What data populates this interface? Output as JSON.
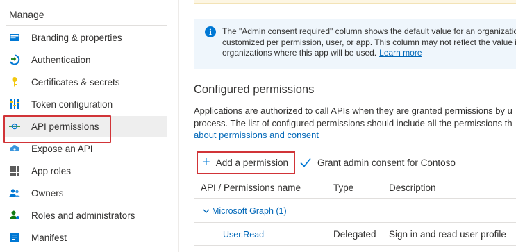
{
  "sidebar": {
    "heading": "Manage",
    "items": [
      {
        "label": "Branding & properties",
        "icon": "branding-icon"
      },
      {
        "label": "Authentication",
        "icon": "authentication-icon"
      },
      {
        "label": "Certificates & secrets",
        "icon": "key-icon"
      },
      {
        "label": "Token configuration",
        "icon": "token-bars-icon"
      },
      {
        "label": "API permissions",
        "icon": "api-permissions-icon",
        "selected": true
      },
      {
        "label": "Expose an API",
        "icon": "cloud-icon"
      },
      {
        "label": "App roles",
        "icon": "grid-icon"
      },
      {
        "label": "Owners",
        "icon": "people-icon"
      },
      {
        "label": "Roles and administrators",
        "icon": "person-badge-icon"
      },
      {
        "label": "Manifest",
        "icon": "manifest-icon"
      }
    ]
  },
  "info": {
    "line1": "The \"Admin consent required\" column shows the default value for an organizatio",
    "line2": "customized per permission, user, or app. This column may not reflect the value in",
    "line3": "organizations where this app will be used.",
    "learn_more": "Learn more"
  },
  "configured": {
    "title": "Configured permissions",
    "desc_line1": "Applications are authorized to call APIs when they are granted permissions by u",
    "desc_line2": "process. The list of configured permissions should include all the permissions th",
    "desc_link": "about permissions and consent"
  },
  "toolbar": {
    "add_label": "Add a permission",
    "grant_label": "Grant admin consent for Contoso"
  },
  "table": {
    "headers": [
      "API / Permissions name",
      "Type",
      "Description"
    ],
    "group": "Microsoft Graph (1)",
    "rows": [
      {
        "name": "User.Read",
        "type": "Delegated",
        "description": "Sign in and read user profile"
      }
    ]
  },
  "colors": {
    "accent": "#0078d4",
    "link": "#0067b8",
    "highlight_border": "#d13438",
    "info_background": "#eff6fc"
  }
}
